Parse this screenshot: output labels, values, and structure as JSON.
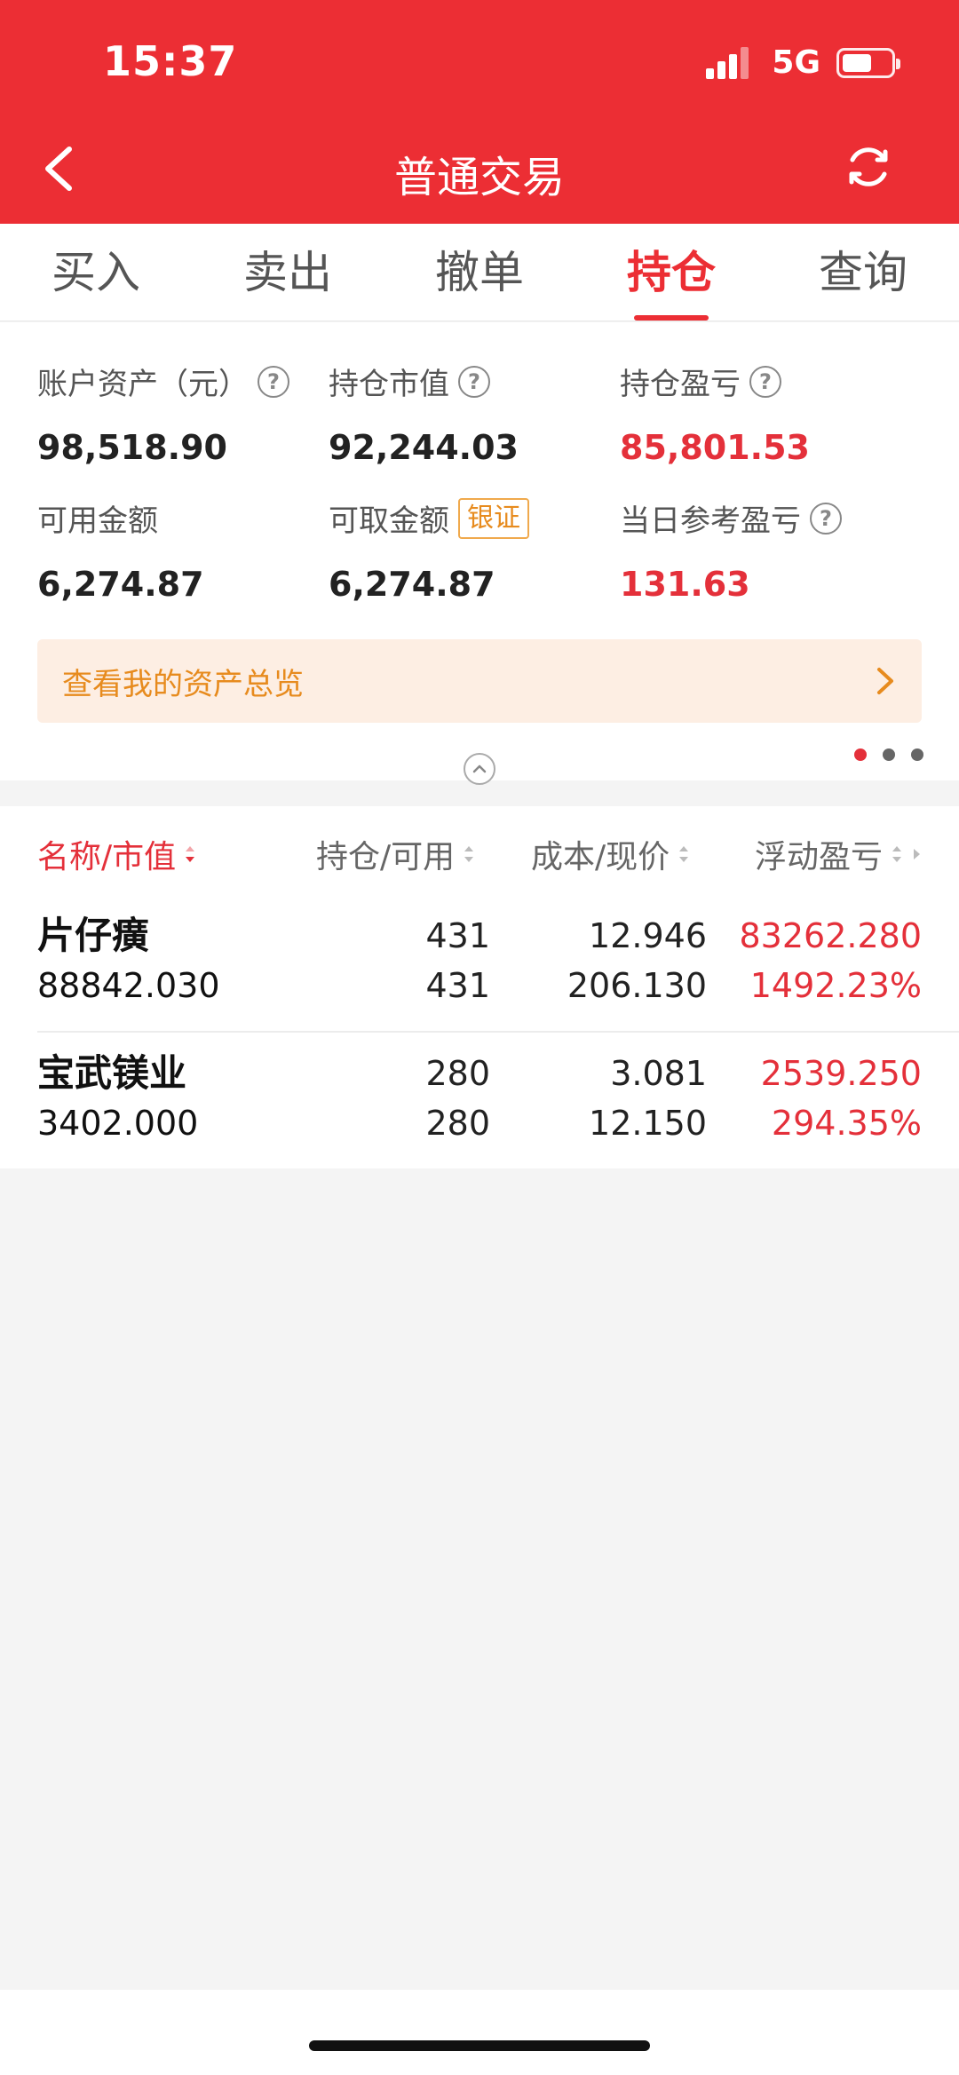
{
  "status_bar": {
    "time": "15:37",
    "network": "5G",
    "battery_level": 0.6
  },
  "header": {
    "title": "普通交易"
  },
  "tabs": [
    {
      "label": "买入",
      "active": false
    },
    {
      "label": "卖出",
      "active": false
    },
    {
      "label": "撤单",
      "active": false
    },
    {
      "label": "持仓",
      "active": true
    },
    {
      "label": "查询",
      "active": false
    }
  ],
  "assets": {
    "account_assets": {
      "label": "账户资产（元）",
      "value": "98,518.90"
    },
    "market_value": {
      "label": "持仓市值",
      "value": "92,244.03"
    },
    "position_pl": {
      "label": "持仓盈亏",
      "value": "85,801.53"
    },
    "available": {
      "label": "可用金额",
      "value": "6,274.87"
    },
    "withdrawable": {
      "label": "可取金额",
      "badge": "银证",
      "value": "6,274.87"
    },
    "daily_pl": {
      "label": "当日参考盈亏",
      "value": "131.63"
    },
    "overview_link": "查看我的资产总览",
    "help_symbol": "?"
  },
  "table": {
    "headers": [
      "名称/市值",
      "持仓/可用",
      "成本/现价",
      "浮动盈亏"
    ],
    "rows": [
      {
        "name": "片仔癀",
        "market_value": "88842.030",
        "position": "431",
        "available": "431",
        "cost": "12.946",
        "price": "206.130",
        "pl": "83262.280",
        "pl_pct": "1492.23%"
      },
      {
        "name": "宝武镁业",
        "market_value": "3402.000",
        "position": "280",
        "available": "280",
        "cost": "3.081",
        "price": "12.150",
        "pl": "2539.250",
        "pl_pct": "294.35%"
      }
    ]
  },
  "colors": {
    "brand_red": "#ec2e34",
    "profit_red": "#e4303a",
    "accent_orange": "#e78b1e"
  }
}
